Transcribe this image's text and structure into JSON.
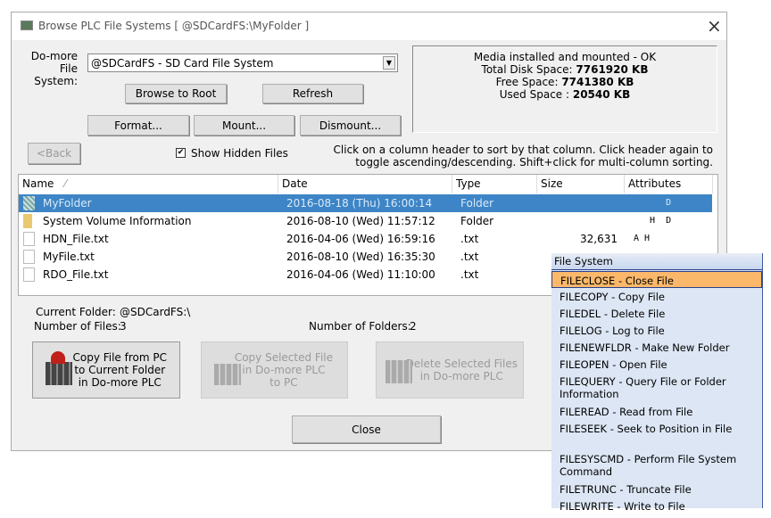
{
  "window": {
    "title": "Browse PLC File Systems [ @SDCardFS:\\MyFolder ]",
    "close_icon": "×"
  },
  "fs_label_1": "Do-more",
  "fs_label_2": "File System:",
  "fs_select": "@SDCardFS - SD Card File System",
  "buttons": {
    "browse_root": "Browse to Root",
    "refresh": "Refresh",
    "format": "Format...",
    "mount": "Mount...",
    "dismount": "Dismount...",
    "back": "<Back",
    "close": "Close"
  },
  "show_hidden": {
    "label": "Show Hidden Files",
    "checked": true
  },
  "info": {
    "status": "Media installed and mounted - OK",
    "total_label": "Total Disk Space: ",
    "total": "7761920 KB",
    "free_label": "Free Space: ",
    "free": "7741380 KB",
    "used_label": "Used Space : ",
    "used": "20540 KB"
  },
  "hint_1": "Click on a column header to sort by that column.  Click header again to",
  "hint_2": "toggle ascending/descending.  Shift+click for multi-column sorting.",
  "columns": [
    "Name",
    "Date",
    "Type",
    "Size",
    "Attributes"
  ],
  "sort_indicator": "⁄",
  "rows": [
    {
      "name": "MyFolder",
      "date": "2016-08-18 (Thu) 16:00:14",
      "type": "Folder",
      "size": "",
      "attr": "      D",
      "icon": "folder-icon"
    },
    {
      "name": "System Volume Information",
      "date": "2016-08-10 (Wed) 11:57:12",
      "type": "Folder",
      "size": "",
      "attr": "   H  D",
      "icon": "folder-icon"
    },
    {
      "name": "HDN_File.txt",
      "date": "2016-04-06 (Wed) 16:59:16",
      "type": ".txt",
      "size": "32,631",
      "attr": "A H",
      "icon": "file-icon"
    },
    {
      "name": "MyFile.txt",
      "date": "2016-08-10 (Wed) 16:35:30",
      "type": ".txt",
      "size": "",
      "attr": "",
      "icon": "file-icon"
    },
    {
      "name": "RDO_File.txt",
      "date": "2016-04-06 (Wed) 11:10:00",
      "type": ".txt",
      "size": "",
      "attr": "",
      "icon": "file-icon"
    }
  ],
  "current_folder_label": "Current Folder:",
  "current_folder": "@SDCardFS:\\",
  "num_files_label": "Number of Files:",
  "num_files": "3",
  "num_folders_label": "Number of Folders:",
  "num_folders": "2",
  "actions": {
    "copy_from_pc": [
      "Copy File from PC",
      "to Current Folder",
      "in Do-more PLC"
    ],
    "copy_to_pc": [
      "Copy Selected File",
      "in Do-more PLC",
      "to PC"
    ],
    "delete": [
      "Delete Selected Files",
      "in Do-more PLC"
    ]
  },
  "popup": {
    "header": "File System",
    "highlight_color": "#fbb86a",
    "items": [
      "FILECLOSE - Close File",
      "FILECOPY - Copy File",
      "FILEDEL - Delete File",
      "FILELOG - Log to File",
      "FILENEWFLDR - Make New Folder",
      "FILEOPEN - Open File",
      "FILEQUERY - Query File or Folder Information",
      "FILEREAD - Read from File",
      "FILESEEK - Seek to Position in File",
      "FILESYSCMD - Perform File System Command",
      "FILETRUNC - Truncate File",
      "FILEWRITE - Write to File"
    ]
  }
}
